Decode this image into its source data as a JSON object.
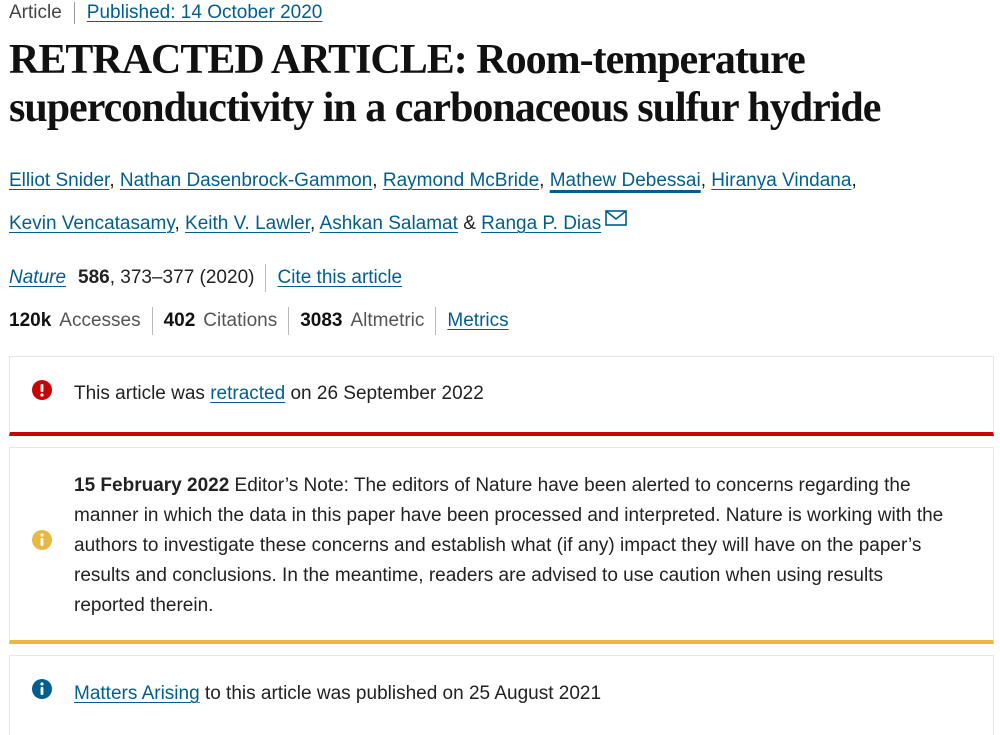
{
  "header": {
    "type": "Article",
    "published": "Published: 14 October 2020"
  },
  "title": "RETRACTED ARTICLE: Room-temperature superconductivity in a carbonaceous sulfur hydride",
  "authors": [
    "Elliot Snider",
    "Nathan Dasenbrock-Gammon",
    "Raymond McBride",
    "Mathew Debessai",
    "Hiranya Vindana",
    "Kevin Vencatasamy",
    "Keith V. Lawler",
    "Ashkan Salamat",
    "Ranga P. Dias"
  ],
  "authors_ampersand": "&",
  "citation": {
    "journal": "Nature",
    "volume": "586",
    "pages_year": ", 373–377 (2020)",
    "cite_link": "Cite this article"
  },
  "metrics": {
    "accesses_value": "120k",
    "accesses_label": "Accesses",
    "citations_value": "402",
    "citations_label": "Citations",
    "altmetric_value": "3083",
    "altmetric_label": "Altmetric",
    "metrics_link": "Metrics"
  },
  "notices": {
    "retraction": {
      "prefix": "This article was ",
      "link": "retracted",
      "suffix": " on 26 September 2022",
      "color": "#c40606"
    },
    "editor_note": {
      "date": "15 February 2022",
      "body": " Editor’s Note: The editors of Nature have been alerted to concerns regarding the manner in which the data in this paper have been processed and interpreted. Nature is working with the authors to investigate these concerns and establish what (if any) impact they will have on the paper’s results and conclusions. In the meantime, readers are advised to use caution when using results reported therein.",
      "color": "#e8b844"
    },
    "matters_arising": {
      "link": "Matters Arising",
      "suffix": " to this article was published on 25 August 2021",
      "color": "#025e8d"
    }
  },
  "icons": {
    "error": "exclamation-circle-icon",
    "warning": "info-circle-icon",
    "info": "info-circle-icon",
    "mail": "mail-icon"
  }
}
